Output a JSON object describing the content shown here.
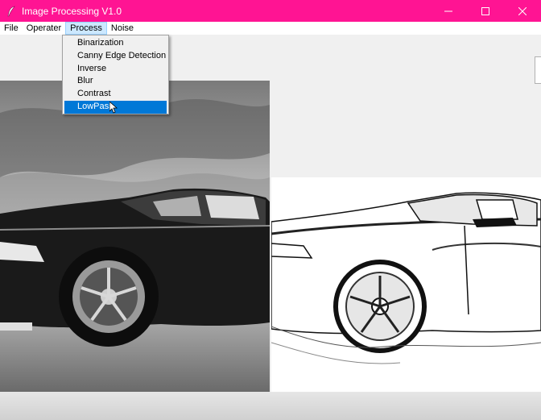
{
  "window": {
    "title": "Image Processing V1.0",
    "title_bar_color": "#ff1493",
    "controls": [
      "minimize-icon",
      "maximize-icon",
      "close-icon"
    ]
  },
  "menubar": {
    "items": [
      {
        "label": "File"
      },
      {
        "label": "Operater"
      },
      {
        "label": "Process"
      },
      {
        "label": "Noise"
      }
    ],
    "active_item": "Process"
  },
  "process_menu": {
    "items": [
      {
        "label": "Binarization"
      },
      {
        "label": "Canny Edge Detection"
      },
      {
        "label": "Inverse"
      },
      {
        "label": "Blur"
      },
      {
        "label": "Contrast"
      },
      {
        "label": "LowPass"
      }
    ],
    "highlighted": "LowPass",
    "highlight_color": "#0078d7"
  },
  "images": {
    "original": {
      "content": "grayscale photo of a car"
    },
    "processed": {
      "content": "high-contrast processed car image"
    }
  }
}
